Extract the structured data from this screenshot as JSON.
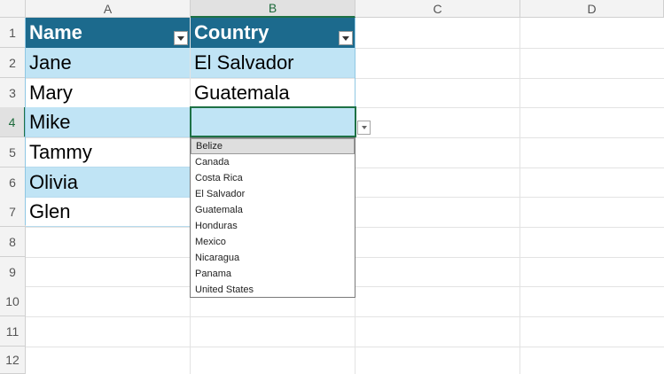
{
  "columns": [
    "A",
    "B",
    "C",
    "D"
  ],
  "rows": [
    "1",
    "2",
    "3",
    "4",
    "5",
    "6",
    "7",
    "8",
    "9",
    "10",
    "11",
    "12"
  ],
  "table": {
    "headers": [
      "Name",
      "Country"
    ],
    "names": [
      "Jane",
      "Mary",
      "Mike",
      "Tammy",
      "Olivia",
      "Glen"
    ],
    "countries": [
      "El Salvador",
      "Guatemala",
      "",
      "",
      "",
      ""
    ]
  },
  "dropdown": {
    "options": [
      "Belize",
      "Canada",
      "Costa Rica",
      "El Salvador",
      "Guatemala",
      "Honduras",
      "Mexico",
      "Nicaragua",
      "Panama",
      "United States"
    ],
    "highlighted": "Belize"
  },
  "colors": {
    "header": "#1c6a8d",
    "band": "#c0e4f5",
    "selection": "#1e7145"
  }
}
